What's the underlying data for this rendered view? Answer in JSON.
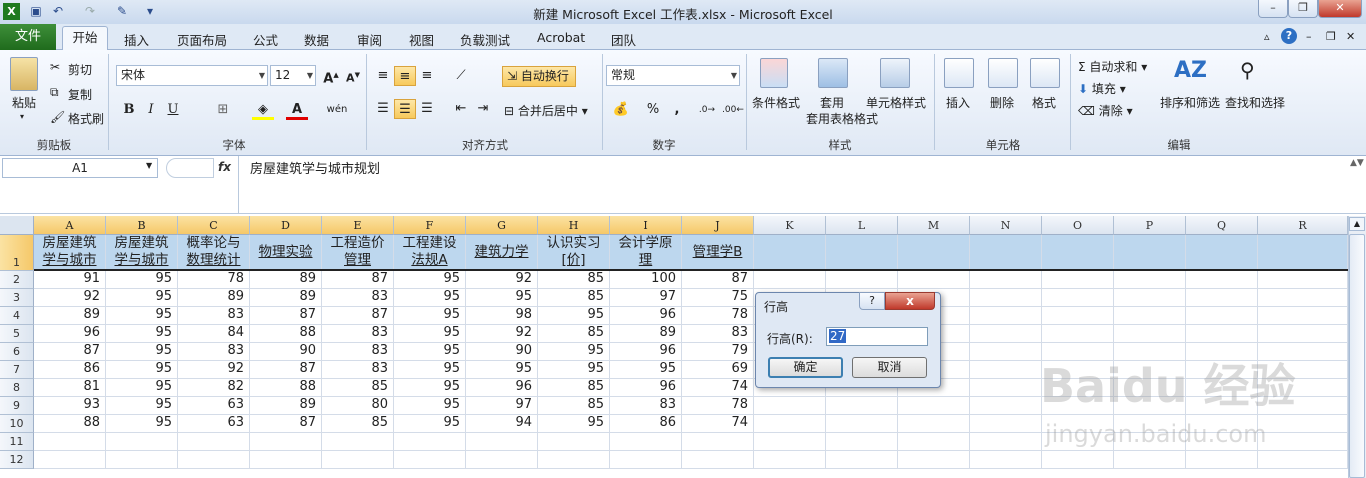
{
  "window": {
    "title": "新建 Microsoft Excel 工作表.xlsx  -  Microsoft Excel"
  },
  "tabs": [
    "文件",
    "开始",
    "插入",
    "页面布局",
    "公式",
    "数据",
    "审阅",
    "视图",
    "负载测试",
    "Acrobat",
    "团队"
  ],
  "ribbon": {
    "clipboard": {
      "paste": "粘贴",
      "cut": "剪切",
      "copy": "复制",
      "format_painter": "格式刷",
      "group": "剪贴板"
    },
    "font": {
      "name": "宋体",
      "size": "12",
      "bold": "B",
      "italic": "I",
      "underline": "U",
      "group": "字体"
    },
    "alignment": {
      "wrap": "自动换行",
      "merge": "合并后居中",
      "group": "对齐方式"
    },
    "number": {
      "format": "常规",
      "percent": "%",
      "comma": ",",
      "group": "数字"
    },
    "styles": {
      "conditional": "条件格式",
      "table": "套用表格格式",
      "cell_styles": "单元格样式",
      "group": "样式"
    },
    "cells": {
      "insert": "插入",
      "delete": "删除",
      "format": "格式",
      "group": "单元格"
    },
    "editing": {
      "autosum": "自动求和",
      "fill": "填充",
      "clear": "清除",
      "sort": "排序和筛选",
      "find": "查找和选择",
      "group": "编辑"
    }
  },
  "formula_bar": {
    "name_box": "A1",
    "fx": "fx",
    "value": "房屋建筑学与城市规划"
  },
  "columns": [
    "A",
    "B",
    "C",
    "D",
    "E",
    "F",
    "G",
    "H",
    "I",
    "J",
    "K",
    "L",
    "M",
    "N",
    "O",
    "P",
    "Q",
    "R"
  ],
  "header_row": [
    [
      "房屋建筑",
      "学与城市"
    ],
    [
      "房屋建筑",
      "学与城市"
    ],
    [
      "概率论与",
      "数理统计"
    ],
    [
      "物理实验",
      ""
    ],
    [
      "工程造价",
      "管理"
    ],
    [
      "工程建设",
      "法规A"
    ],
    [
      "建筑力学",
      ""
    ],
    [
      "认识实习",
      "[价]"
    ],
    [
      "会计学原",
      "理"
    ],
    [
      "管理学B",
      ""
    ]
  ],
  "rows": [
    [
      91,
      95,
      78,
      89,
      87,
      95,
      92,
      85,
      100,
      87
    ],
    [
      92,
      95,
      89,
      89,
      83,
      95,
      95,
      85,
      97,
      75
    ],
    [
      89,
      95,
      83,
      87,
      87,
      95,
      98,
      95,
      96,
      78
    ],
    [
      96,
      95,
      84,
      88,
      83,
      95,
      92,
      85,
      89,
      83
    ],
    [
      87,
      95,
      83,
      90,
      83,
      95,
      90,
      95,
      96,
      79
    ],
    [
      86,
      95,
      92,
      87,
      83,
      95,
      95,
      95,
      95,
      69
    ],
    [
      81,
      95,
      82,
      88,
      85,
      95,
      96,
      85,
      96,
      74
    ],
    [
      93,
      95,
      63,
      89,
      80,
      95,
      97,
      85,
      83,
      78
    ],
    [
      88,
      95,
      63,
      87,
      85,
      95,
      94,
      95,
      86,
      74
    ]
  ],
  "row_numbers": [
    "1",
    "2",
    "3",
    "4",
    "5",
    "6",
    "7",
    "8",
    "9",
    "10",
    "11",
    "12"
  ],
  "dialog": {
    "title": "行高",
    "help": "?",
    "close": "x",
    "label": "行高(R):",
    "value": "27",
    "ok": "确定",
    "cancel": "取消"
  },
  "watermark": {
    "brand": "Baidu 经验",
    "url": "jingyan.baidu.com"
  }
}
